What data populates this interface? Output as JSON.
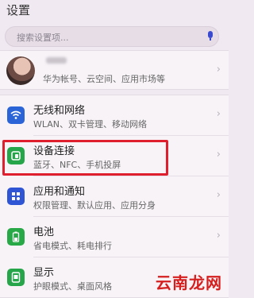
{
  "header": {
    "title": "设置"
  },
  "search": {
    "placeholder": "搜索设置项..."
  },
  "account": {
    "subtitle": "华为帐号、云空间、应用市场等"
  },
  "settings": [
    {
      "title": "无线和网络",
      "subtitle": "WLAN、双卡管理、移动网络",
      "icon": "wifi-icon",
      "color": "#2a64d6"
    },
    {
      "title": "设备连接",
      "subtitle": "蓝牙、NFC、手机投屏",
      "icon": "device-connect-icon",
      "color": "#27a54a"
    },
    {
      "title": "应用和通知",
      "subtitle": "权限管理、默认应用、应用分身",
      "icon": "apps-icon",
      "color": "#2f55d4"
    },
    {
      "title": "电池",
      "subtitle": "省电模式、耗电排行",
      "icon": "battery-icon",
      "color": "#28a846"
    },
    {
      "title": "显示",
      "subtitle": "护眼模式、桌面风格",
      "icon": "display-icon",
      "color": "#27a54a"
    }
  ],
  "watermark": {
    "text": "云南龙网"
  },
  "colors": {
    "highlight": "#e01f2e"
  }
}
